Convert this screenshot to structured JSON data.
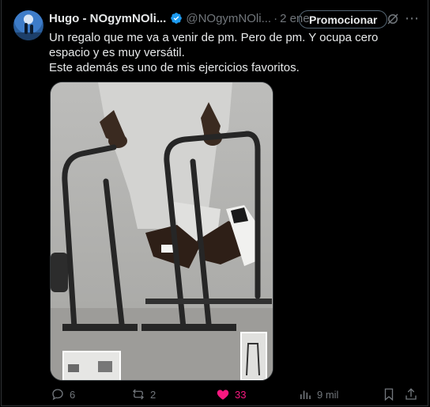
{
  "tweet": {
    "author_name": "Hugo - NOgymNOli...",
    "handle": "@NOgymNOli...",
    "separator": "·",
    "date": "2 ene.",
    "promote_label": "Promocionar",
    "text_line1": "Un regalo que me va a venir de pm. Pero de pm. Y ocupa cero espacio y es muy versátil.",
    "text_line2": "Este además es uno de mis ejercicios favoritos."
  },
  "actions": {
    "replies": "6",
    "reposts": "2",
    "likes": "33",
    "views": "9 mil"
  },
  "colors": {
    "background": "#000000",
    "text": "#e7e9ea",
    "muted": "#71767b",
    "verified": "#1d9bf0",
    "like": "#f91880"
  },
  "icons": [
    "verified-badge-icon",
    "grok-icon",
    "more-icon",
    "reply-icon",
    "repost-icon",
    "like-icon",
    "views-icon",
    "bookmark-icon",
    "share-icon"
  ]
}
